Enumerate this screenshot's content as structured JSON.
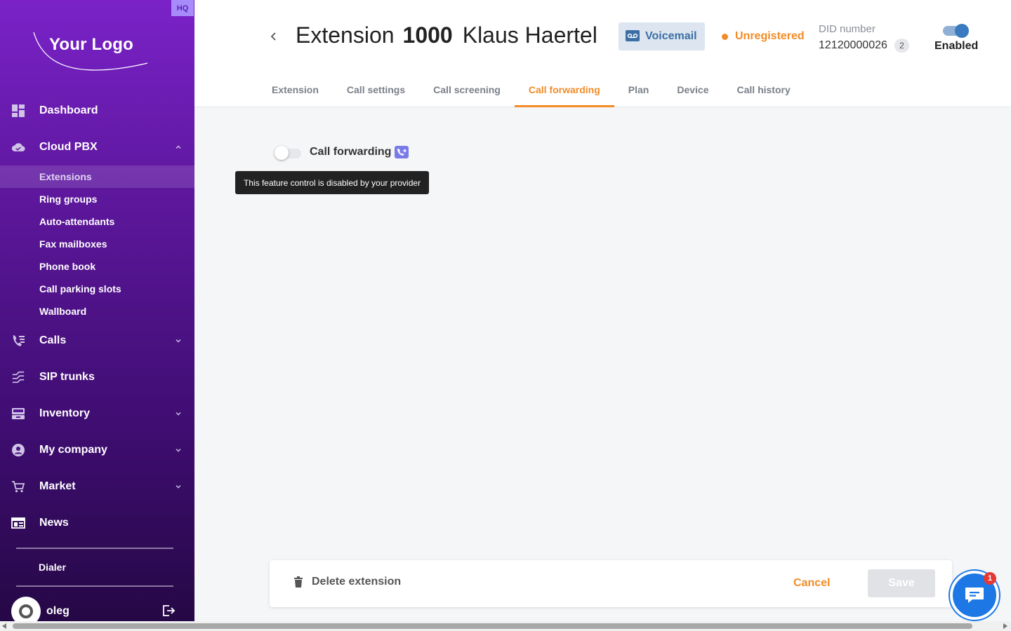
{
  "sidebar": {
    "badge": "HQ",
    "logo_text": "Your Logo",
    "items": [
      {
        "label": "Dashboard",
        "icon": "dashboard-icon"
      },
      {
        "label": "Cloud PBX",
        "icon": "cloud-icon"
      },
      {
        "label": "Calls",
        "icon": "call-list-icon"
      },
      {
        "label": "SIP trunks",
        "icon": "trunk-icon"
      },
      {
        "label": "Inventory",
        "icon": "inventory-icon"
      },
      {
        "label": "My company",
        "icon": "account-icon"
      },
      {
        "label": "Market",
        "icon": "cart-icon"
      },
      {
        "label": "News",
        "icon": "news-icon"
      }
    ],
    "sub_items": [
      "Extensions",
      "Ring groups",
      "Auto-attendants",
      "Fax mailboxes",
      "Phone book",
      "Call parking slots",
      "Wallboard"
    ],
    "active_sub": "Extensions",
    "dialer": "Dialer",
    "username": "oleg"
  },
  "header": {
    "title_prefix": "Extension",
    "ext_number": "1000",
    "ext_name": "Klaus Haertel",
    "voicemail_label": "Voicemail",
    "status": "Unregistered",
    "status_color": "#f28c28",
    "did_label": "DID number",
    "did_value": "12120000026",
    "did_count": "2",
    "enabled_label": "Enabled",
    "enabled": true,
    "accent": "#f28c28"
  },
  "tabs": [
    "Extension",
    "Call settings",
    "Call screening",
    "Call forwarding",
    "Plan",
    "Device",
    "Call history"
  ],
  "active_tab": "Call forwarding",
  "content": {
    "call_forwarding_label": "Call forwarding",
    "call_forwarding_enabled": false,
    "tooltip": "This feature control is disabled by your provider"
  },
  "footer": {
    "delete_label": "Delete extension",
    "cancel_label": "Cancel",
    "save_label": "Save"
  },
  "chat": {
    "badge": "1"
  }
}
